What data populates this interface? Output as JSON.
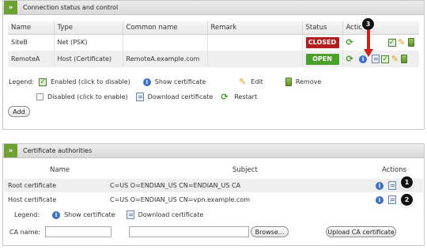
{
  "panel1": {
    "title": "Connection status and control",
    "headers": [
      "Name",
      "Type",
      "Common name",
      "Remark",
      "Status",
      "Actions"
    ],
    "rows": [
      {
        "name": "SiteB",
        "type": "Net (PSK)",
        "common_name": "",
        "remark": "",
        "status": "CLOSED"
      },
      {
        "name": "RemoteA",
        "type": "Host (Certificate)",
        "common_name": "RemoteA.example.com",
        "remark": "",
        "status": "OPEN"
      }
    ],
    "legend_label": "Legend:",
    "legend": {
      "enabled": "Enabled (click to disable)",
      "show_cert": "Show certificate",
      "edit": "Edit",
      "remove": "Remove",
      "disabled": "Disabled (click to enable)",
      "download_cert": "Download certificate",
      "restart": "Restart"
    },
    "add_button": "Add"
  },
  "panel2": {
    "title": "Certificate authorities",
    "headers": [
      "Name",
      "Subject",
      "Actions"
    ],
    "rows": [
      {
        "name": "Root certificate",
        "subject": "C=US O=ENDIAN_US CN=ENDIAN_US CA"
      },
      {
        "name": "Host certificate",
        "subject": "C=US O=ENDIAN_US CN=vpn.example.com"
      }
    ],
    "legend_label": "Legend:",
    "legend": {
      "show_cert": "Show certificate",
      "download_cert": "Download certificate"
    },
    "ca_name_label": "CA name:",
    "ca_name_value": "",
    "file_value": "",
    "browse_button": "Browse...",
    "upload_button": "Upload CA certificate"
  },
  "callouts": [
    "3",
    "1",
    "2"
  ],
  "colors": {
    "closed": "#b21d1d",
    "open": "#49a12a",
    "header_accent": "#6fa034",
    "arrow": "#d0201c"
  },
  "icons": [
    "info-icon",
    "certificate-icon",
    "checkbox-checked-icon",
    "checkbox-unchecked-icon",
    "pencil-icon",
    "trash-icon",
    "restart-icon",
    "chevron-right-icon"
  ]
}
